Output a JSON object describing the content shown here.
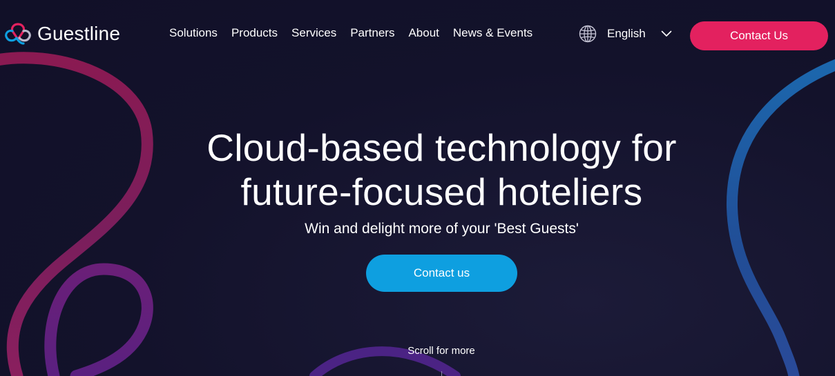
{
  "brand": {
    "name": "Guestline",
    "colors": {
      "primary_pink": "#e3215f",
      "primary_blue": "#0e9fe0",
      "background": "#13122b"
    }
  },
  "nav": {
    "items": [
      {
        "label": "Solutions"
      },
      {
        "label": "Products"
      },
      {
        "label": "Services"
      },
      {
        "label": "Partners"
      },
      {
        "label": "About"
      },
      {
        "label": "News & Events"
      }
    ]
  },
  "language": {
    "icon": "globe-icon",
    "selected": "English"
  },
  "header": {
    "contact_label": "Contact Us"
  },
  "hero": {
    "title_line1": "Cloud-based technology for",
    "title_line2": "future-focused hoteliers",
    "subtitle": "Win and delight more of your 'Best Guests'",
    "cta_label": "Contact us",
    "scroll_label": "Scroll for more"
  }
}
